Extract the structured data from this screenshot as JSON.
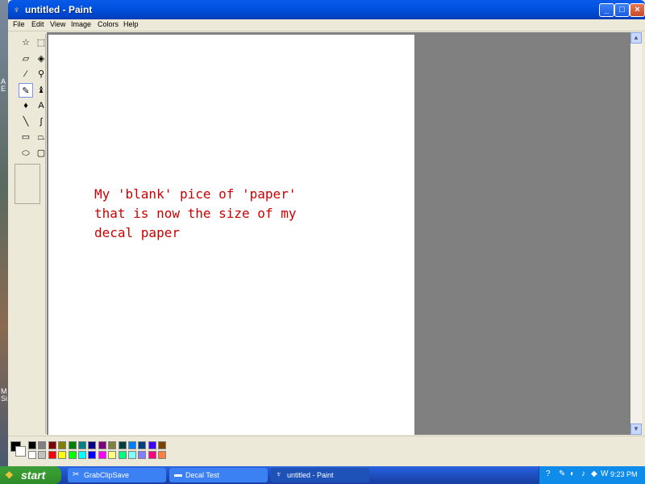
{
  "window": {
    "title": "untitled - Paint"
  },
  "menu": [
    "File",
    "Edit",
    "View",
    "Image",
    "Colors",
    "Help"
  ],
  "tools": [
    {
      "name": "free-select-icon",
      "glyph": "☆"
    },
    {
      "name": "rect-select-icon",
      "glyph": "⬚"
    },
    {
      "name": "eraser-icon",
      "glyph": "▱"
    },
    {
      "name": "fill-bucket-icon",
      "glyph": "◈"
    },
    {
      "name": "color-picker-icon",
      "glyph": "⁄"
    },
    {
      "name": "magnifier-icon",
      "glyph": "⚲"
    },
    {
      "name": "pencil-icon",
      "glyph": "✎"
    },
    {
      "name": "brush-icon",
      "glyph": "♝"
    },
    {
      "name": "airbrush-icon",
      "glyph": "♦"
    },
    {
      "name": "text-tool-icon",
      "glyph": "A"
    },
    {
      "name": "line-tool-icon",
      "glyph": "╲"
    },
    {
      "name": "curve-tool-icon",
      "glyph": "∫"
    },
    {
      "name": "rectangle-tool-icon",
      "glyph": "▭"
    },
    {
      "name": "polygon-tool-icon",
      "glyph": "⏢"
    },
    {
      "name": "ellipse-tool-icon",
      "glyph": "⬭"
    },
    {
      "name": "rounded-rect-tool-icon",
      "glyph": "▢"
    }
  ],
  "active_tool": 6,
  "canvas": {
    "text": [
      "My 'blank' pice of 'paper'",
      "that is now the size of my",
      "decal paper"
    ]
  },
  "palette": {
    "top": [
      "#000000",
      "#808080",
      "#800000",
      "#808000",
      "#008000",
      "#008080",
      "#000080",
      "#800080",
      "#808040",
      "#004040",
      "#0080ff",
      "#004080",
      "#4000ff",
      "#804000"
    ],
    "bottom": [
      "#ffffff",
      "#c0c0c0",
      "#ff0000",
      "#ffff00",
      "#00ff00",
      "#00ffff",
      "#0000ff",
      "#ff00ff",
      "#ffff80",
      "#00ff80",
      "#80ffff",
      "#8080ff",
      "#ff0080",
      "#ff8040"
    ]
  },
  "taskbar": {
    "start_label": "start",
    "buttons": [
      {
        "label": "GrabClipSave",
        "icon": "grabclipsave-icon",
        "glyph": "✂",
        "active": false
      },
      {
        "label": "Decal Test",
        "icon": "folder-icon",
        "glyph": "▬",
        "active": false
      },
      {
        "label": "untitled - Paint",
        "icon": "paint-icon",
        "glyph": "♆",
        "active": true
      }
    ],
    "clock": "9:23 PM"
  },
  "desktop_text": [
    "A",
    "E",
    "M",
    "Si"
  ]
}
